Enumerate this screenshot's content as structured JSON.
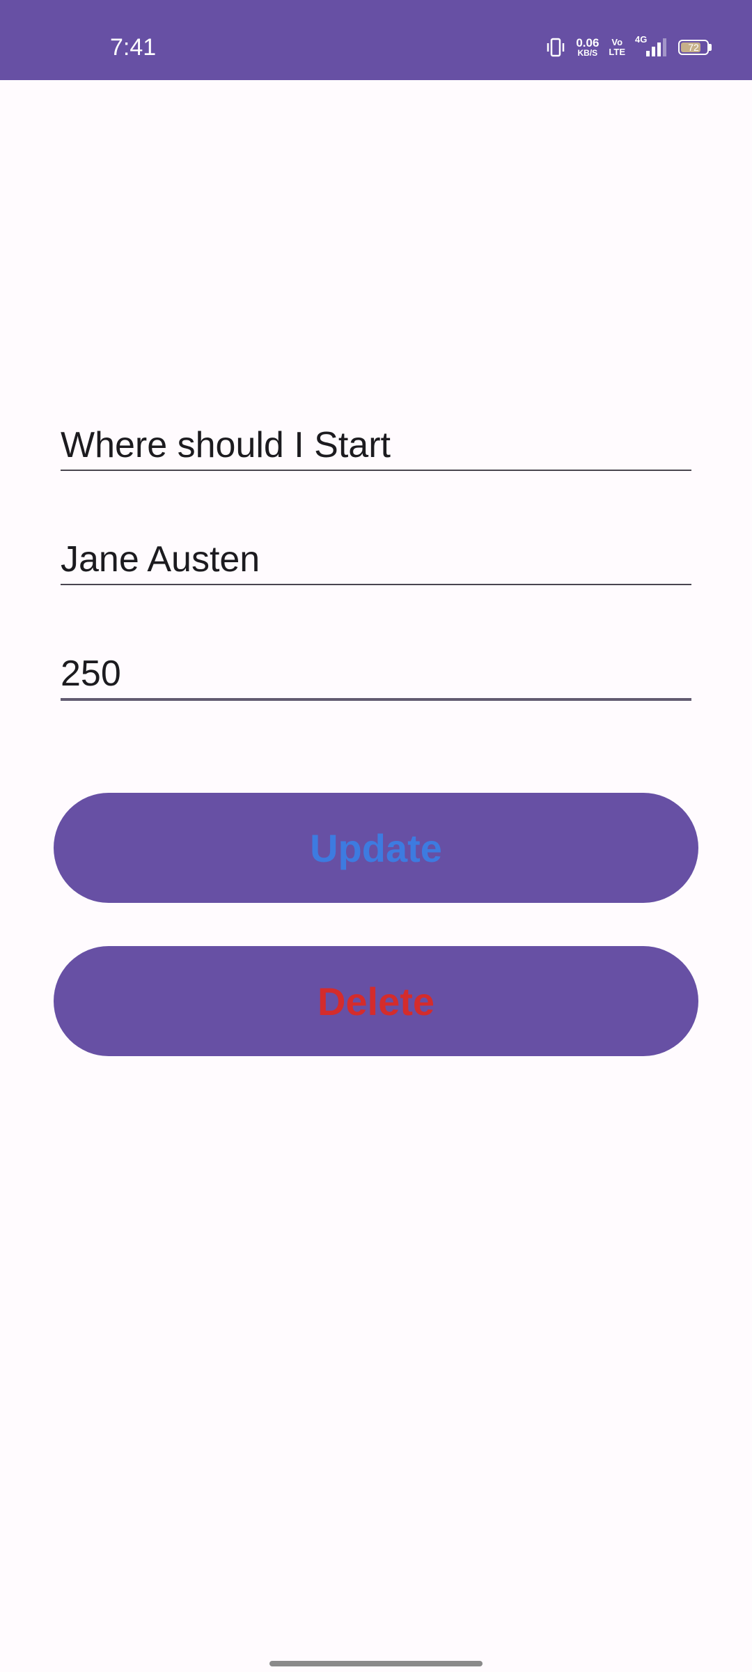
{
  "status_bar": {
    "time": "7:41",
    "net_speed": "0.06",
    "net_speed_unit": "KB/S",
    "volte_top": "Vo",
    "volte_bottom": "LTE",
    "network": "4G",
    "battery_level": "72",
    "icons": [
      "vibrate-icon",
      "network-speed",
      "volte-icon",
      "signal-4g-icon",
      "battery-icon"
    ],
    "color": "#6750a4"
  },
  "form": {
    "title_value": "Where should I Start",
    "author_value": "Jane Austen",
    "pages_value": "250"
  },
  "buttons": {
    "update_label": "Update",
    "delete_label": "Delete",
    "background": "#6750a4",
    "update_text_color": "#3d7be0",
    "delete_text_color": "#d42c2c"
  },
  "theme": {
    "background": "#fffbfe",
    "accent": "#6750a4"
  }
}
